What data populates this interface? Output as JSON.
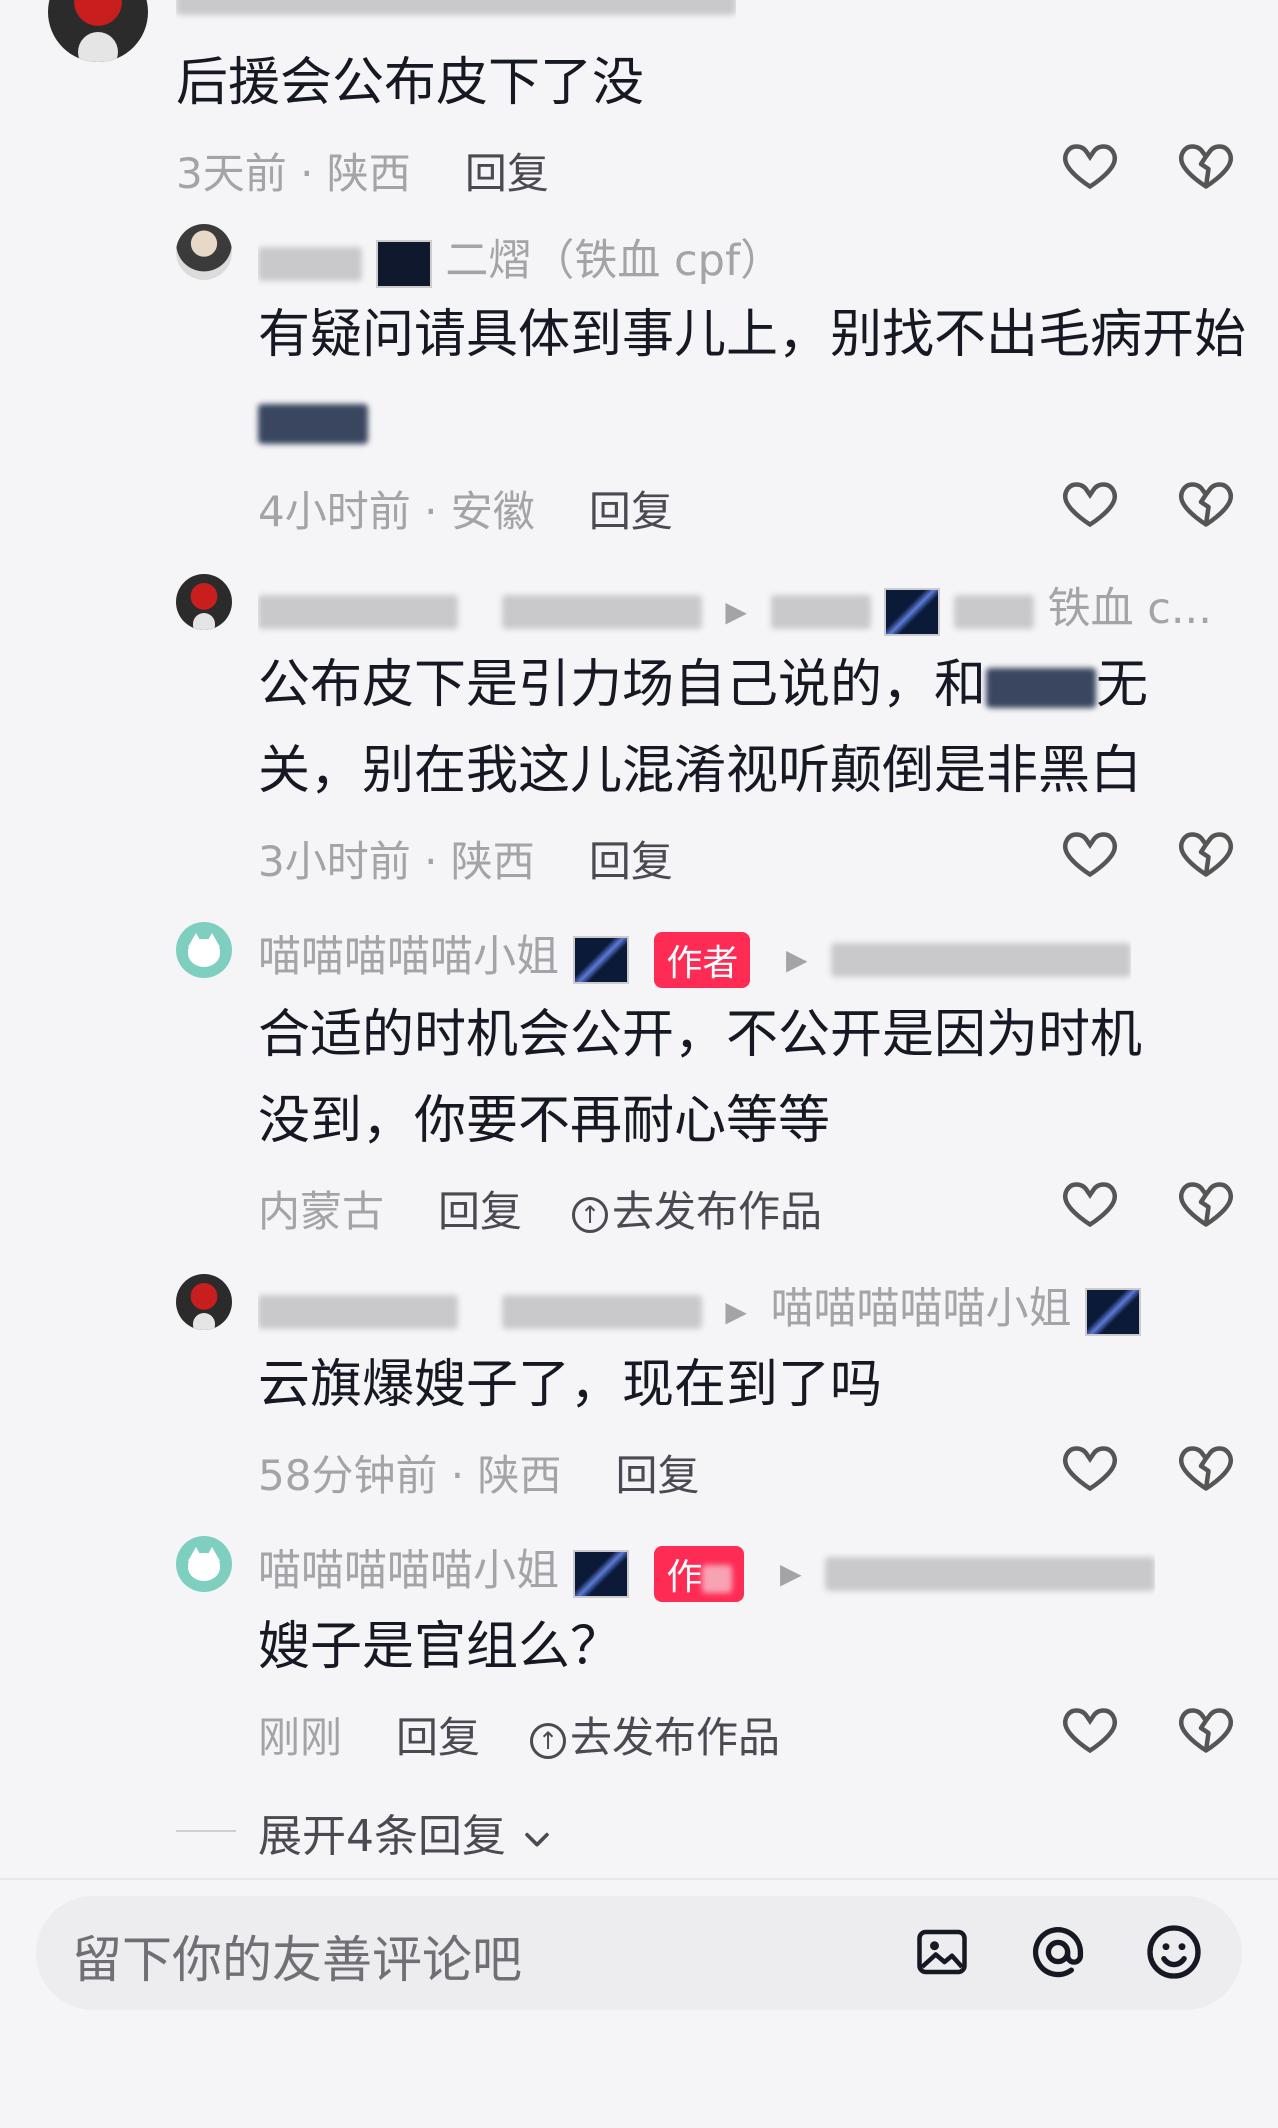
{
  "comments": [
    {
      "id": "c1",
      "name_suffix": "",
      "text": "后援会公布皮下了没",
      "meta_time": "3天前",
      "meta_sep": " · ",
      "meta_loc": "陕西",
      "reply_label": "回复"
    },
    {
      "id": "c2",
      "name_suffix": "二熠（铁血 cpf）",
      "text": "有疑问请具体到事儿上，别找不出毛病开始",
      "meta_time": "4小时前",
      "meta_sep": " · ",
      "meta_loc": "安徽",
      "reply_label": "回复"
    },
    {
      "id": "c3",
      "name_suffix": "铁血 c...",
      "text_line1": "公布皮下是引力场自己说的，和",
      "text_line1_end": "无",
      "text_line2": "关，别在我这儿混淆视听颠倒是非黑白",
      "meta_time": "3小时前",
      "meta_sep": " · ",
      "meta_loc": "陕西",
      "reply_label": "回复"
    },
    {
      "id": "c4",
      "name": "喵喵喵喵喵小姐",
      "author_label": "作者",
      "text_line1": "合适的时机会公开，不公开是因为时机",
      "text_line2": "没到，你要不再耐心等等",
      "meta_loc": "内蒙古",
      "reply_label": "回复",
      "publish_label": "去发布作品"
    },
    {
      "id": "c5",
      "reply_to_name": "喵喵喵喵喵小姐",
      "text": "云旗爆嫂子了，现在到了吗",
      "meta_time": "58分钟前",
      "meta_sep": " · ",
      "meta_loc": "陕西",
      "reply_label": "回复"
    },
    {
      "id": "c6",
      "name": "喵喵喵喵喵小姐",
      "author_label": "作",
      "text": "嫂子是官组么？",
      "meta_time": "刚刚",
      "reply_label": "回复",
      "publish_label": "去发布作品"
    }
  ],
  "expand_label": "展开4条回复",
  "input_placeholder": "留下你的友善评论吧",
  "icons": [
    "heart-icon",
    "broken-heart-icon",
    "image-icon",
    "at-icon",
    "emoji-icon",
    "chevron-down-icon"
  ],
  "colors": {
    "author_badge": "#fe2c55",
    "background": "#f5f5f7",
    "text": "#161823",
    "meta": "#a3a3a8"
  }
}
